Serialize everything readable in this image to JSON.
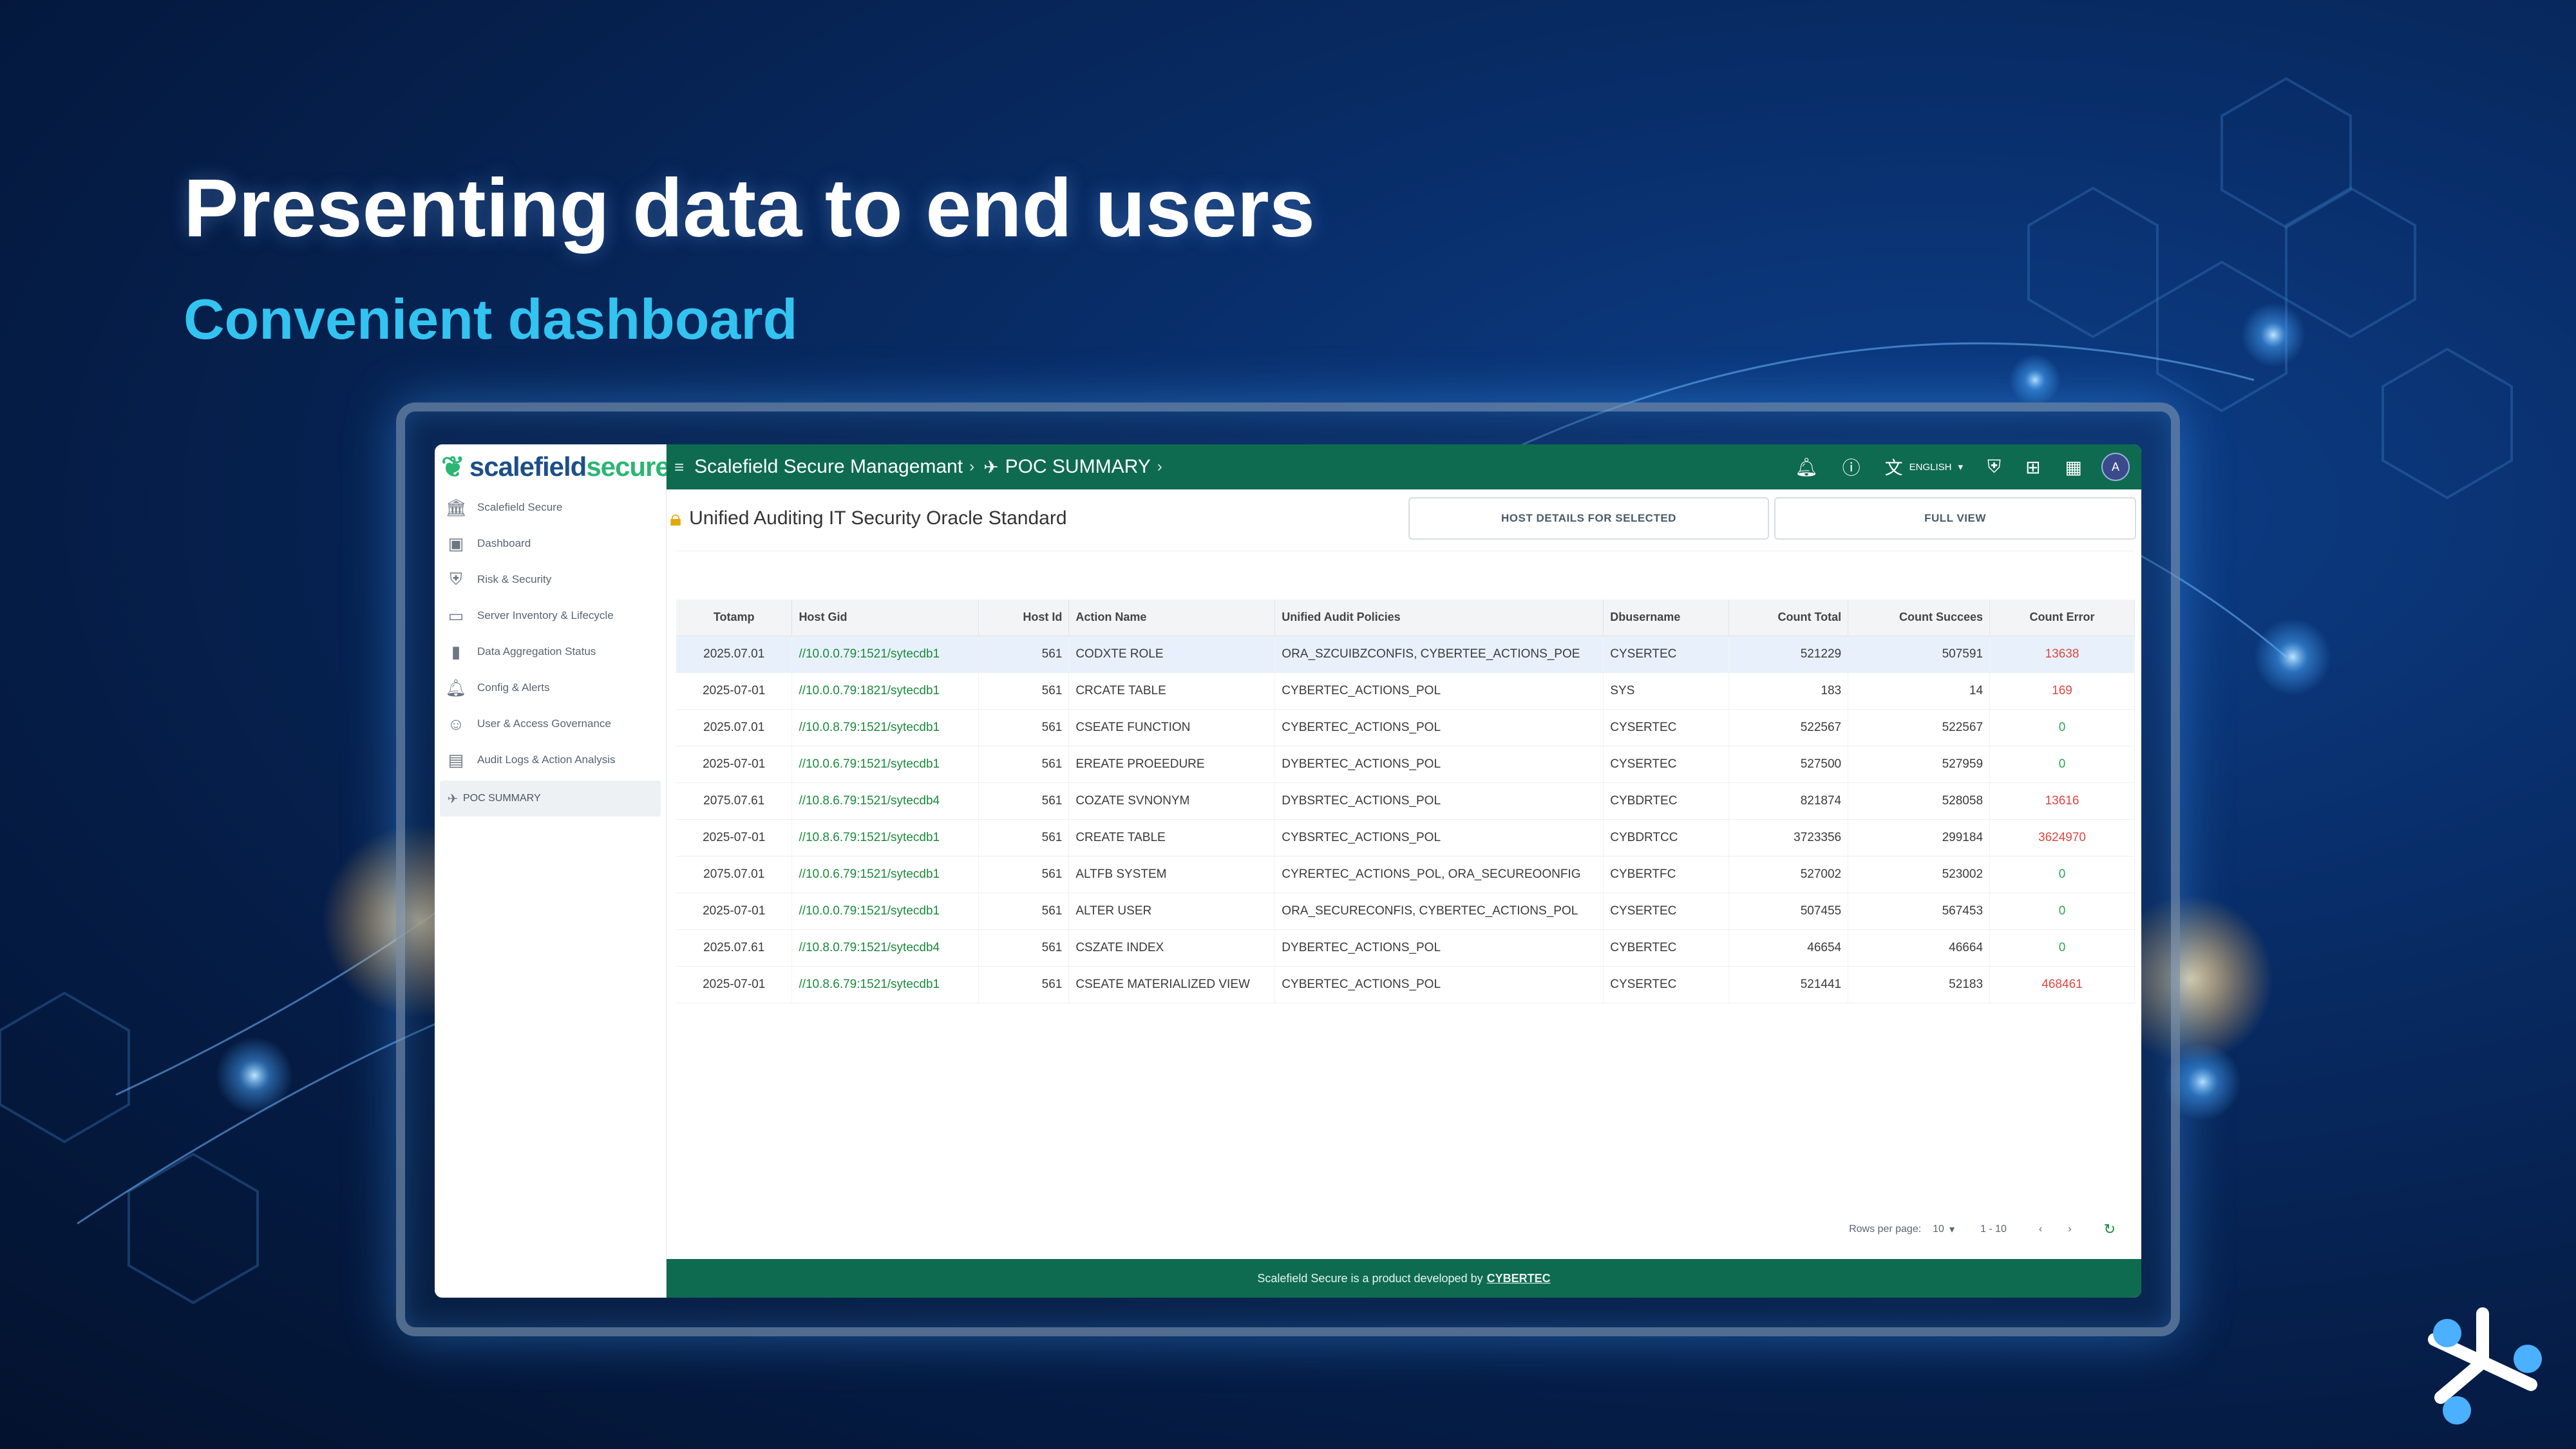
{
  "slide": {
    "headline": "Presenting data to end users",
    "subheadline": "Convenient dashboard"
  },
  "logo": {
    "part1": "scalefield",
    "part2": "secure"
  },
  "sidebar": {
    "items": [
      {
        "label": "Scalefield Secure",
        "icon": "bank-icon"
      },
      {
        "label": "Dashboard",
        "icon": "dashboard-icon"
      },
      {
        "label": "Risk & Security",
        "icon": "shield-icon"
      },
      {
        "label": "Server Inventory & Lifecycle",
        "icon": "monitor-icon"
      },
      {
        "label": "Data Aggregation Status",
        "icon": "bar-chart-icon"
      },
      {
        "label": "Config & Alerts",
        "icon": "bell-icon"
      },
      {
        "label": "User & Access Governance",
        "icon": "user-group-icon"
      },
      {
        "label": "Audit Logs & Action Analysis",
        "icon": "log-icon"
      },
      {
        "label": "POC SUMMARY",
        "icon": "rocket-icon",
        "active": true
      }
    ]
  },
  "topbar": {
    "crumb1": "Scalefield Secure Managemant",
    "sep": "›",
    "crumb2": "POC SUMMARY",
    "sep2": "›",
    "language": "ENGLISH",
    "avatar": "A"
  },
  "page": {
    "title": "Unified Auditing IT Security Oracle Standard",
    "btn_host_details": "HOST DETAILS FOR SELECTED",
    "btn_full_view": "FULL VIEW"
  },
  "table": {
    "headers": [
      "Totamp",
      "Host Gid",
      "Host Id",
      "Action Name",
      "Unified Audit Policies",
      "Dbusername",
      "Count Total",
      "Count Succees",
      "Count Error"
    ],
    "rows": [
      [
        "2025.07.01",
        "//10.0.0.79:1521/sytecdb1",
        "561",
        "CODXTE ROLE",
        "ORA_SZCUIBZCONFIS, CYBERTEE_ACTIONS_POE",
        "CYSERTEC",
        "521229",
        "507591",
        "13638"
      ],
      [
        "2025-07-01",
        "//10.0.0.79:1821/sytecdb1",
        "561",
        "CRCATE TABLE",
        "CYBERTEC_ACTIONS_POL",
        "SYS",
        "183",
        "14",
        "169"
      ],
      [
        "2025.07.01",
        "//10.0.8.79:1521/sytecdb1",
        "561",
        "CSEATE FUNCTION",
        "CYBERTEC_ACTIONS_POL",
        "CYSERTEC",
        "522567",
        "522567",
        "0"
      ],
      [
        "2025-07-01",
        "//10.0.6.79:1521/sytecdb1",
        "561",
        "EREATE PROEEDURE",
        "DYBERTEC_ACTIONS_POL",
        "CYSERTEC",
        "527500",
        "527959",
        "0"
      ],
      [
        "2075.07.61",
        "//10.8.6.79:1521/sytecdb4",
        "561",
        "COZATE SVNONYM",
        "DYBSRTEC_ACTIONS_POL",
        "CYBDRTEC",
        "821874",
        "528058",
        "13616"
      ],
      [
        "2025-07-01",
        "//10.8.6.79:1521/sytecdb1",
        "561",
        "CREATE TABLE",
        "CYBSRTEC_ACTIONS_POL",
        "CYBDRTCC",
        "3723356",
        "299184",
        "3624970"
      ],
      [
        "2075.07.01",
        "//10.0.6.79:1521/sytecdb1",
        "561",
        "ALTFB SYSTEM",
        "CYRERTEC_ACTIONS_POL, ORA_SECUREOONFIG",
        "CYBERTFC",
        "527002",
        "523002",
        "0"
      ],
      [
        "2025-07-01",
        "//10.0.0.79:1521/sytecdb1",
        "561",
        "ALTER USER",
        "ORA_SECURECONFIS, CYBERTEC_ACTIONS_POL",
        "CYSERTEC",
        "507455",
        "567453",
        "0"
      ],
      [
        "2025.07.61",
        "//10.8.0.79:1521/sytecdb4",
        "561",
        "CSZATE INDEX",
        "DYBERTEC_ACTIONS_POL",
        "CYBERTEC",
        "46654",
        "46664",
        "0"
      ],
      [
        "2025-07-01",
        "//10.8.6.79:1521/sytecdb1",
        "561",
        "CSEATE MATERIALIZED VIEW",
        "CYBERTEC_ACTIONS_POL",
        "CYSERTEC",
        "521441",
        "52183",
        "468461"
      ]
    ]
  },
  "pager": {
    "rows_label": "Rows per page:",
    "rows_value": "10",
    "range": "1 - 10"
  },
  "footer": {
    "text": "Scalefield Secure is a product developed by",
    "brand": "CYBERTEC"
  },
  "colors": {
    "accent": "#0e6b4f",
    "error": "#e0463e",
    "ok": "#2aa850",
    "headline": "#33c3f0"
  }
}
